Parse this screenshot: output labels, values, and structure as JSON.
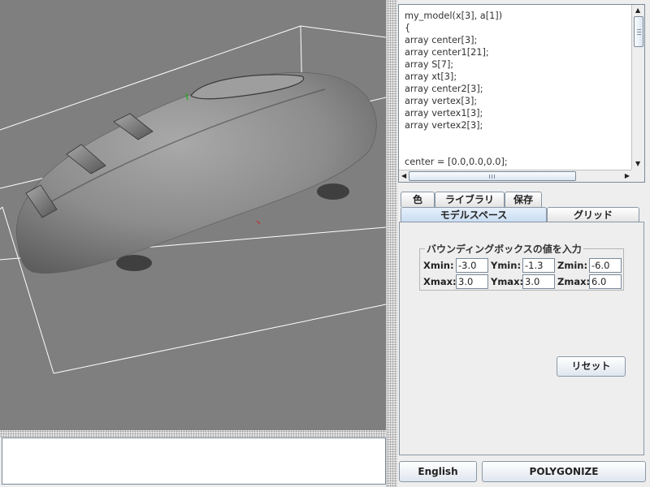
{
  "viewport": {
    "description_colors": {
      "background": "#7f7f7f",
      "model": "#8a8a8a",
      "bbox": "#ffffff"
    }
  },
  "editor": {
    "lines": [
      "my_model(x[3], a[1])",
      "{",
      "array center[3];",
      "array center1[21];",
      "array S[7];",
      "array xt[3];",
      "array center2[3];",
      "array vertex[3];",
      "array vertex1[3];",
      "array vertex2[3];",
      "",
      "",
      "center = [0.0,0.0,0.0];"
    ]
  },
  "tabs": {
    "row1": [
      "色",
      "ライブラリ",
      "保存"
    ],
    "row2": [
      "モデルスペース",
      "グリッド"
    ],
    "selected": "モデルスペース"
  },
  "bbox": {
    "title": "バウンディングボックスの値を入力",
    "xmin_label": "Xmin:",
    "xmin": "-3.0",
    "ymin_label": "Ymin:",
    "ymin": "-1.3",
    "zmin_label": "Zmin:",
    "zmin": "-6.0",
    "xmax_label": "Xmax:",
    "xmax": "3.0",
    "ymax_label": "Ymax:",
    "ymax": "3.0",
    "zmax_label": "Zmax:",
    "zmax": "6.0"
  },
  "buttons": {
    "reset": "リセット",
    "english": "English",
    "polygonize": "POLYGONIZE"
  },
  "console": {
    "text": ""
  }
}
